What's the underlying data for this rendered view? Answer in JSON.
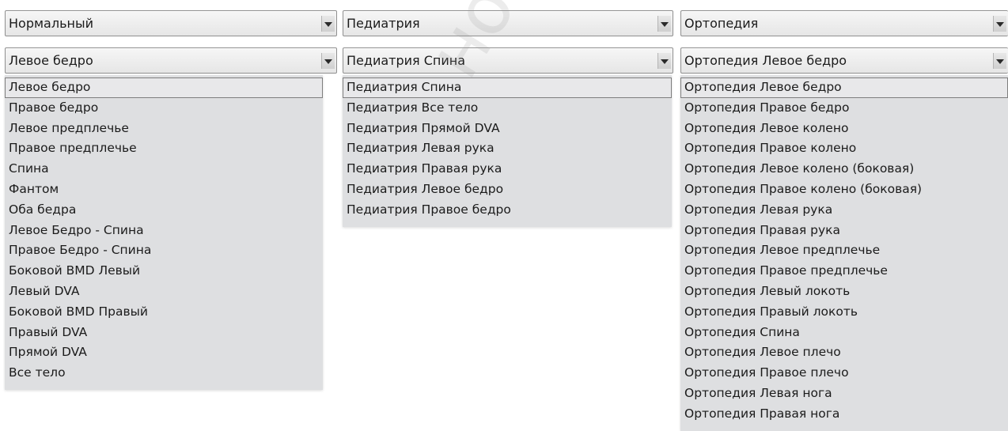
{
  "panels": [
    {
      "mode_value": "Нормальный",
      "scan_value": "Левое бедро",
      "options": [
        "Левое бедро",
        "Правое бедро",
        "Левое предплечье",
        "Правое предплечье",
        "Спина",
        "Фантом",
        "Оба бедра",
        "Левое Бедро - Спина",
        "Правое Бедро - Спина",
        "Боковой BMD Левый",
        "Левый DVA",
        "Боковой BMD Правый",
        "Правый DVA",
        "Прямой DVA",
        "Все тело"
      ]
    },
    {
      "mode_value": "Педиатрия",
      "scan_value": "Педиатрия Спина",
      "options": [
        "Педиатрия Спина",
        "Педиатрия Все тело",
        "Педиатрия Прямой DVA",
        "Педиатрия Левая рука",
        "Педиатрия Правая рука",
        "Педиатрия Левое бедро",
        "Педиатрия Правое бедро"
      ]
    },
    {
      "mode_value": "Ортопедия",
      "scan_value": "Ортопедия Левое бедро",
      "options": [
        "Ортопедия Левое бедро",
        "Ортопедия Правое бедро",
        "Ортопедия Левое колено",
        "Ортопедия Правое колено",
        "Ортопедия Левое колено (боковая)",
        "Ортопедия Правое колено (боковая)",
        "Ортопедия Левая рука",
        "Ортопедия Правая рука",
        "Ортопедия Левое предплечье",
        "Ортопедия Правое предплечье",
        "Ортопедия Левый локоть",
        "Ортопедия Правый локоть",
        "Ортопедия Спина",
        "Ортопедия Левое плечо",
        "Ортопедия Правое плечо",
        "Ортопедия Левая нога",
        "Ортопедия Правая нога"
      ]
    }
  ],
  "selected_index": 0,
  "watermark": "ного сайта"
}
